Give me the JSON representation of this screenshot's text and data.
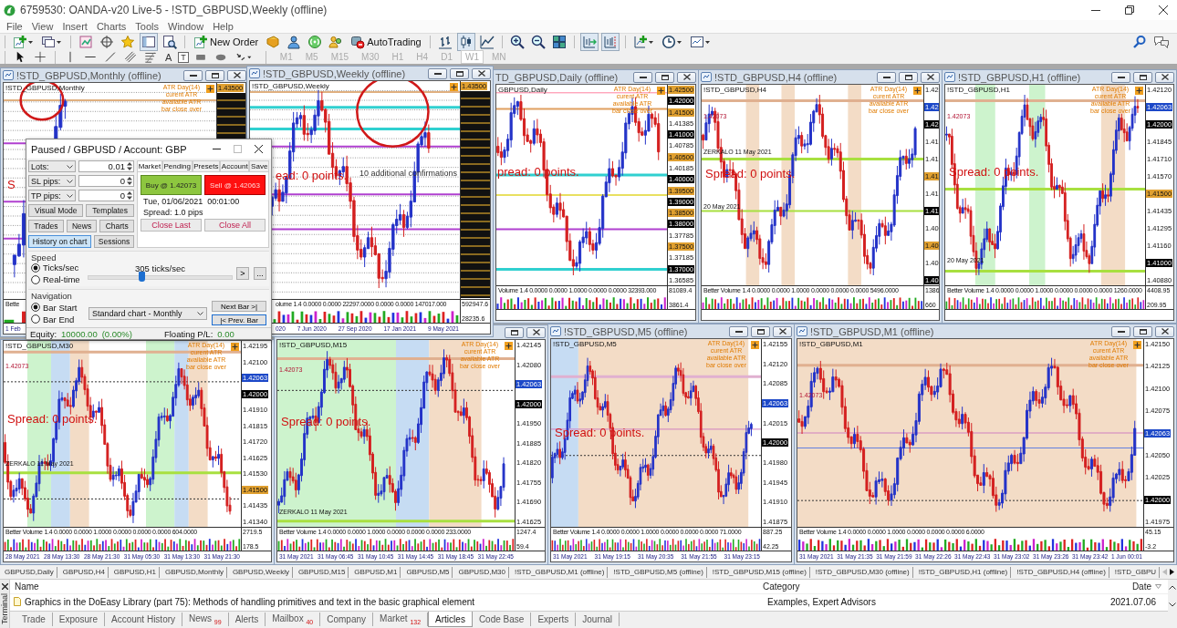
{
  "window": {
    "title": "6759530: OANDA-v20 Live-5 - !STD_GBPUSD,Weekly (offline)"
  },
  "menu": [
    "File",
    "View",
    "Insert",
    "Charts",
    "Tools",
    "Window",
    "Help"
  ],
  "toolbar": [
    [
      {
        "kind": "new_chart",
        "pressed": false
      },
      {
        "kind": "profiles",
        "pressed": false
      }
    ],
    [
      {
        "kind": "market_watch",
        "pressed": false
      },
      {
        "kind": "data_window",
        "pressed": false
      },
      {
        "kind": "navigator",
        "pressed": false
      },
      {
        "kind": "terminal",
        "pressed": true
      },
      {
        "kind": "tester",
        "pressed": false
      }
    ],
    [
      {
        "kind": "new_order",
        "label": "New Order",
        "pressed": false
      },
      {
        "kind": "editor",
        "pressed": false
      },
      {
        "kind": "community",
        "pressed": false
      },
      {
        "kind": "signals",
        "pressed": false
      },
      {
        "kind": "market",
        "pressed": false
      },
      {
        "kind": "autotrading",
        "label": "AutoTrading",
        "pressed": false
      }
    ],
    [
      {
        "kind": "bars",
        "pressed": false
      },
      {
        "kind": "candles",
        "pressed": true
      },
      {
        "kind": "line",
        "pressed": false
      }
    ],
    [
      {
        "kind": "zoom_in",
        "pressed": false
      },
      {
        "kind": "zoom_out",
        "pressed": false
      },
      {
        "kind": "tile",
        "pressed": false
      }
    ],
    [
      {
        "kind": "autoscroll",
        "pressed": true
      },
      {
        "kind": "shift",
        "pressed": true
      }
    ],
    [
      {
        "kind": "indicators",
        "pressed": false
      },
      {
        "kind": "periods",
        "pressed": false
      },
      {
        "kind": "templates",
        "pressed": false
      }
    ]
  ],
  "drawing_toolbar": {
    "glyphs": [
      "A",
      "T"
    ],
    "timeframes": [
      {
        "label": "M1",
        "selected": false,
        "disabled": true
      },
      {
        "label": "M5",
        "selected": false,
        "disabled": true
      },
      {
        "label": "M15",
        "selected": false,
        "disabled": true
      },
      {
        "label": "M30",
        "selected": false,
        "disabled": true
      },
      {
        "label": "H1",
        "selected": false,
        "disabled": true
      },
      {
        "label": "H4",
        "selected": false,
        "disabled": true
      },
      {
        "label": "D1",
        "selected": false,
        "disabled": true
      },
      {
        "label": "W1",
        "selected": true,
        "disabled": true
      },
      {
        "label": "MN",
        "selected": false,
        "disabled": true
      }
    ]
  },
  "charts": [
    {
      "title": "!STD_GBPUSD,Monthly (offline)",
      "symbol": "!STD_GBPUSD,Monthly",
      "atr": [
        "ATR Day(14)",
        "curent ATR",
        "available ATR",
        "bar close over"
      ],
      "spread": "S",
      "prices": [
        {
          "label": "1.43500",
          "kind": "gold"
        }
      ],
      "volume": "Bette",
      "times": [
        "1 Feb"
      ]
    },
    {
      "title": "!STD_GBPUSD,Weekly (offline)",
      "symbol": "!STD_GBPUSD,Weekly",
      "notes": [
        {
          "text": "10 additional confirmations",
          "kind": "label"
        }
      ],
      "spread": "ead: 0 points.",
      "prices": [
        {
          "label": "1.43500",
          "kind": "gold"
        }
      ],
      "volume": "olume 1.4 0.0000 0.0000 22297.0000 0.0000 0.0000 147017.000",
      "volume_scale": [
        "592947.6",
        "28235.6"
      ],
      "times": [
        "020",
        "7 Jun 2020",
        "27 Sep 2020",
        "17 Jan 2021",
        "9 May 2021"
      ]
    },
    {
      "title": "TD_GBPUSD,Daily (offline)",
      "symbol": "GBPUSD,Daily",
      "atr": [
        "ATR Day(14)",
        "curent ATR",
        "available ATR",
        "bar close over"
      ],
      "spread": "pread: 0 points.",
      "prices": [
        {
          "label": "1.42500",
          "kind": "gold"
        },
        {
          "label": "1.42000",
          "kind": "black"
        },
        {
          "label": "1.41500",
          "kind": "gold"
        },
        {
          "label": "1.41385",
          "kind": "plain"
        },
        {
          "label": "1.41000",
          "kind": "black"
        },
        {
          "label": "1.40785",
          "kind": "plain"
        },
        {
          "label": "1.40500",
          "kind": "gold"
        },
        {
          "label": "1.40185",
          "kind": "plain"
        },
        {
          "label": "1.40000",
          "kind": "black"
        },
        {
          "label": "1.39500",
          "kind": "gold"
        },
        {
          "label": "1.39000",
          "kind": "black"
        },
        {
          "label": "1.38500",
          "kind": "gold"
        },
        {
          "label": "1.38000",
          "kind": "black"
        },
        {
          "label": "1.37785",
          "kind": "plain"
        },
        {
          "label": "1.37500",
          "kind": "gold"
        },
        {
          "label": "1.37185",
          "kind": "plain"
        },
        {
          "label": "1.37000",
          "kind": "black"
        },
        {
          "label": "1.36585",
          "kind": "plain"
        }
      ],
      "volume": "Volume 1.4 0.0000 0.0000 1.0000 0.0000 0.0000 32393.000",
      "volume_scale": [
        "81089.4",
        "3861.4"
      ]
    },
    {
      "title": "!STD_GBPUSD,H4 (offline)",
      "symbol": "!STD_GBPUSD,H4",
      "atr": [
        "ATR Day(14)",
        "curent ATR",
        "available ATR",
        "bar close over"
      ],
      "notes": [
        {
          "text": "1.42073",
          "kind": "price"
        },
        {
          "text": "ZERKALO 11 May 2021",
          "kind": "marker"
        },
        {
          "text": "20 May 2021",
          "kind": "date"
        }
      ],
      "spread": "Spread: 0 points.",
      "prices": [
        {
          "label": "1.42",
          "kind": "plain"
        },
        {
          "label": "1.42",
          "kind": "blue"
        },
        {
          "label": "1.42",
          "kind": "black"
        },
        {
          "label": "1.41",
          "kind": "plain"
        },
        {
          "label": "1.41",
          "kind": "plain"
        },
        {
          "label": "1.41",
          "kind": "gold"
        },
        {
          "label": "1.41",
          "kind": "plain"
        },
        {
          "label": "1.41",
          "kind": "black"
        },
        {
          "label": "1.40",
          "kind": "plain"
        },
        {
          "label": "1.40",
          "kind": "gold"
        },
        {
          "label": "1.40",
          "kind": "plain"
        },
        {
          "label": "1.40",
          "kind": "black"
        }
      ],
      "volume": "Better Volume 1.4 0.0000 0.0000 1.0000 0.0000 0.0000 0.0000 5496.0000",
      "volume_scale": [
        "1386",
        "660"
      ]
    },
    {
      "title": "!STD_GBPUSD,H1 (offline)",
      "symbol": "!STD_GBPUSD,H1",
      "atr": [
        "ATR Day(14)",
        "curent ATR",
        "available ATR",
        "bar close over"
      ],
      "notes": [
        {
          "text": "1.42073",
          "kind": "price"
        },
        {
          "text": "20 May 2021",
          "kind": "date"
        }
      ],
      "spread": "Spread: 0 points.",
      "prices": [
        {
          "label": "1.42120",
          "kind": "plain"
        },
        {
          "label": "1.42063",
          "kind": "blue"
        },
        {
          "label": "1.42000",
          "kind": "black"
        },
        {
          "label": "1.41845",
          "kind": "plain"
        },
        {
          "label": "1.41710",
          "kind": "plain"
        },
        {
          "label": "1.41570",
          "kind": "plain"
        },
        {
          "label": "1.41500",
          "kind": "gold"
        },
        {
          "label": "1.41435",
          "kind": "plain"
        },
        {
          "label": "1.41295",
          "kind": "plain"
        },
        {
          "label": "1.41160",
          "kind": "plain"
        },
        {
          "label": "1.41000",
          "kind": "black"
        },
        {
          "label": "1.40880",
          "kind": "plain"
        }
      ],
      "volume": "Better Volume 1.4 0.0000 0.0000 1.0000 0.0000 0.0000 0.0000 1260.0000",
      "volume_scale": [
        "4408.95",
        "209.95"
      ]
    },
    {
      "symbol": "!STD_GBPUSD,M30",
      "atr": [
        "ATR Day(14)",
        "curent ATR",
        "available ATR",
        "bar close over"
      ],
      "notes": [
        {
          "text": "1.42073",
          "kind": "price"
        },
        {
          "text": "ZERKALO 11 May 2021",
          "kind": "marker"
        }
      ],
      "spread": "Spread: 0 points.",
      "prices": [
        {
          "label": "1.42195",
          "kind": "plain"
        },
        {
          "label": "1.42100",
          "kind": "plain"
        },
        {
          "label": "1.42063",
          "kind": "blue"
        },
        {
          "label": "1.42000",
          "kind": "black"
        },
        {
          "label": "1.41910",
          "kind": "plain"
        },
        {
          "label": "1.41815",
          "kind": "plain"
        },
        {
          "label": "1.41720",
          "kind": "plain"
        },
        {
          "label": "1.41625",
          "kind": "plain"
        },
        {
          "label": "1.41530",
          "kind": "plain"
        },
        {
          "label": "1.41500",
          "kind": "gold"
        },
        {
          "label": "1.41435",
          "kind": "plain"
        },
        {
          "label": "1.41340",
          "kind": "plain"
        }
      ],
      "volume": "Better Volume 1.4 0.0000 0.0000 1.0000 0.0000 0.0000 0.0000 604.0000",
      "volume_scale": [
        "2719.5",
        "178.5"
      ],
      "times": [
        "28 May 2021",
        "28 May 13:30",
        "28 May 21:30",
        "31 May 05:30",
        "31 May 13:30",
        "31 May 21:30"
      ]
    },
    {
      "symbol": "!STD_GBPUSD,M15",
      "atr": [
        "ATR Day(14)",
        "curent ATR",
        "available ATR",
        "bar close over"
      ],
      "notes": [
        {
          "text": "1.42073",
          "kind": "price"
        },
        {
          "text": "ZERKALO 11 May 2021",
          "kind": "marker"
        }
      ],
      "spread": "Spread: 0 points.",
      "prices": [
        {
          "label": "1.42145",
          "kind": "plain"
        },
        {
          "label": "1.42080",
          "kind": "plain"
        },
        {
          "label": "1.42063",
          "kind": "blue"
        },
        {
          "label": "1.42000",
          "kind": "black"
        },
        {
          "label": "1.41950",
          "kind": "plain"
        },
        {
          "label": "1.41885",
          "kind": "plain"
        },
        {
          "label": "1.41820",
          "kind": "plain"
        },
        {
          "label": "1.41755",
          "kind": "plain"
        },
        {
          "label": "1.41690",
          "kind": "plain"
        },
        {
          "label": "1.41625",
          "kind": "plain"
        }
      ],
      "volume": "Better Volume 1.4 0.0000 0.0000 1.0000 0.0000 0.0000 0.0000 233.0000",
      "volume_scale": [
        "1247.4",
        "59.4"
      ],
      "times": [
        "31 May 2021",
        "31 May 06:45",
        "31 May 10:45",
        "31 May 14:45",
        "31 May 18:45",
        "31 May 22:45"
      ]
    },
    {
      "title": "!STD_GBPUSD,M5 (offline)",
      "symbol": "!STD_GBPUSD,M5",
      "atr": [
        "ATR Day(14)",
        "curent ATR",
        "available ATR",
        "bar close over"
      ],
      "spread": "Spread: 0 points.",
      "prices": [
        {
          "label": "1.42155",
          "kind": "plain"
        },
        {
          "label": "1.42120",
          "kind": "plain"
        },
        {
          "label": "1.42085",
          "kind": "plain"
        },
        {
          "label": "1.42063",
          "kind": "blue"
        },
        {
          "label": "1.42015",
          "kind": "plain"
        },
        {
          "label": "1.42000",
          "kind": "black"
        },
        {
          "label": "1.41980",
          "kind": "plain"
        },
        {
          "label": "1.41945",
          "kind": "plain"
        },
        {
          "label": "1.41910",
          "kind": "plain"
        },
        {
          "label": "1.41875",
          "kind": "plain"
        }
      ],
      "volume": "Better Volume 1.4 0.0000 0.0000 1.0000 0.0000 0.0000 0.0000 71.0000",
      "volume_scale": [
        "887.25",
        "42.25"
      ],
      "times": [
        "31 May 2021",
        "31 May 19:15",
        "31 May 20:35",
        "31 May 21:55",
        "31 May 23:15"
      ]
    },
    {
      "title": "!STD_GBPUSD,M1 (offline)",
      "symbol": "!STD_GBPUSD,M1",
      "atr": [
        "ATR Day(14)",
        "curent ATR",
        "available ATR",
        "bar close over"
      ],
      "notes": [
        {
          "text": "1.42073",
          "kind": "price"
        }
      ],
      "prices": [
        {
          "label": "1.42150",
          "kind": "plain"
        },
        {
          "label": "1.42125",
          "kind": "plain"
        },
        {
          "label": "1.42100",
          "kind": "plain"
        },
        {
          "label": "1.42075",
          "kind": "plain"
        },
        {
          "label": "1.42063",
          "kind": "blue"
        },
        {
          "label": "1.42050",
          "kind": "plain"
        },
        {
          "label": "1.42025",
          "kind": "plain"
        },
        {
          "label": "1.42000",
          "kind": "black"
        },
        {
          "label": "1.41975",
          "kind": "plain"
        }
      ],
      "volume": "Better Volume 1.4 0.0000 0.0000 1.0000 0.0000 0.0000 0.0000 6.0000",
      "volume_scale": [
        "45.15",
        "-3.2"
      ],
      "times": [
        "31 May 2021",
        "31 May 21:35",
        "31 May 21:59",
        "31 May 22:26",
        "31 May 22:43",
        "31 May 23:02",
        "31 May 23:26",
        "31 May 23:42",
        "1 Jun 00:01"
      ]
    }
  ],
  "tester_panel": {
    "title": "Paused / GBPUSD / Account: GBP",
    "inputs": [
      {
        "label": "Lots:",
        "value": "0.01"
      },
      {
        "label": "SL pips:",
        "value": "0"
      },
      {
        "label": "TP pips:",
        "value": "0"
      }
    ],
    "button_rows": [
      [
        {
          "label": "Visual Mode",
          "selected": false
        },
        {
          "label": "Templates",
          "selected": false
        }
      ],
      [
        {
          "label": "Trades",
          "selected": false
        },
        {
          "label": "News",
          "selected": false
        },
        {
          "label": "Charts",
          "selected": false
        }
      ],
      [
        {
          "label": "History on chart",
          "selected": true
        },
        {
          "label": "Sessions",
          "selected": false
        }
      ]
    ],
    "tabs": [
      {
        "label": "Market",
        "selected": true
      },
      {
        "label": "Pending",
        "selected": false
      },
      {
        "label": "Presets",
        "selected": false
      },
      {
        "label": "Account",
        "selected": false
      },
      {
        "label": "Save",
        "selected": false
      }
    ],
    "buy": "Buy @ 1.42073",
    "sell": "Sell @ 1.42063",
    "datetime": "Tue, 01/06/2021  00:01:00",
    "spread": "Spread: 1.0 pips",
    "close_buttons": [
      "Close Last",
      "Close All"
    ],
    "speed": {
      "title": "Speed",
      "modes": [
        {
          "label": "Ticks/sec",
          "selected": true
        },
        {
          "label": "Real-time",
          "selected": false
        }
      ],
      "reading": "305 ticks/sec",
      "level": 0.37,
      "buttons": [
        ">",
        "..."
      ]
    },
    "navigation": {
      "title": "Navigation",
      "modes": [
        {
          "label": "Bar Start",
          "selected": true
        },
        {
          "label": "Bar End",
          "selected": false
        }
      ],
      "chart": "Standard chart - Monthly",
      "buttons": [
        {
          "label": "Next Bar >|",
          "focused": false
        },
        {
          "label": "|< Prev. Bar",
          "focused": true
        }
      ]
    },
    "equity_label": "Equity:",
    "equity": "10000.00",
    "equity_change": "(0.00%)",
    "pl_label": "Floating P/L:",
    "pl": "0.00"
  },
  "chart_tabs": [
    {
      "label": "GBPUSD,Daily",
      "selected": false
    },
    {
      "label": "GBPUSD,H4",
      "selected": false
    },
    {
      "label": "GBPUSD,H1",
      "selected": false
    },
    {
      "label": "GBPUSD,Monthly",
      "selected": false
    },
    {
      "label": "GBPUSD,Weekly",
      "selected": false
    },
    {
      "label": "GBPUSD,M15",
      "selected": false
    },
    {
      "label": "GBPUSD,M1",
      "selected": false
    },
    {
      "label": "GBPUSD,M5",
      "selected": false
    },
    {
      "label": "GBPUSD,M30",
      "selected": false
    },
    {
      "label": "!STD_GBPUSD,M1 (offline)",
      "selected": false
    },
    {
      "label": "!STD_GBPUSD,M5 (offline)",
      "selected": false
    },
    {
      "label": "!STD_GBPUSD,M15 (offline)",
      "selected": false
    },
    {
      "label": "!STD_GBPUSD,M30 (offline)",
      "selected": false
    },
    {
      "label": "!STD_GBPUSD,H1 (offline)",
      "selected": false
    },
    {
      "label": "!STD_GBPUSD,H4 (offline)",
      "selected": false
    },
    {
      "label": "!STD_GBPU",
      "selected": false
    }
  ],
  "terminal": {
    "title": "Terminal",
    "columns": [
      "Name",
      "Category",
      "Date"
    ],
    "rows": [
      {
        "name": "Graphics in the DoEasy Library (part 75): Methods of handling primitives and text in the basic graphical element",
        "category": "Examples, Expert Advisors",
        "date": "2021.07.06"
      }
    ],
    "tabs": [
      {
        "label": "Trade",
        "selected": false
      },
      {
        "label": "Exposure",
        "selected": false
      },
      {
        "label": "Account History",
        "selected": false
      },
      {
        "label": "News",
        "badge": "99",
        "selected": false
      },
      {
        "label": "Alerts",
        "selected": false
      },
      {
        "label": "Mailbox",
        "badge": "40",
        "selected": false
      },
      {
        "label": "Company",
        "selected": false
      },
      {
        "label": "Market",
        "badge": "132",
        "selected": false
      },
      {
        "label": "Articles",
        "selected": true
      },
      {
        "label": "Code Base",
        "selected": false
      },
      {
        "label": "Experts",
        "selected": false
      },
      {
        "label": "Journal",
        "selected": false
      }
    ]
  }
}
